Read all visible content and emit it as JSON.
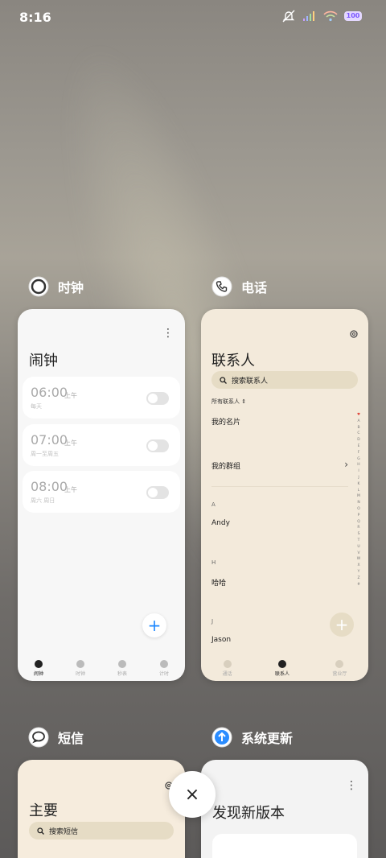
{
  "status": {
    "time": "8:16",
    "battery": "100"
  },
  "apps": {
    "clock": {
      "name": "时钟",
      "title": "闹钟",
      "alarms": [
        {
          "time": "06:00",
          "ampm": "上午",
          "repeat": "每天"
        },
        {
          "time": "07:00",
          "ampm": "上午",
          "repeat": "周一至周五"
        },
        {
          "time": "08:00",
          "ampm": "上午",
          "repeat": "周六 周日"
        }
      ],
      "fab": "+",
      "nav": [
        "闹钟",
        "时钟",
        "秒表",
        "计时"
      ]
    },
    "phone": {
      "name": "电话",
      "title": "联系人",
      "search_placeholder": "搜索联系人",
      "filter": "所有联系人 ⇕",
      "my_card": "我的名片",
      "my_groups": "我的群组",
      "sections": [
        {
          "letter": "A",
          "name": "Andy"
        },
        {
          "letter": "H",
          "name": "哈哈"
        },
        {
          "letter": "J",
          "name": "Jason"
        }
      ],
      "index": [
        "♥",
        "A",
        "B",
        "C",
        "D",
        "E",
        "F",
        "G",
        "H",
        "I",
        "J",
        "K",
        "L",
        "M",
        "N",
        "O",
        "P",
        "Q",
        "R",
        "S",
        "T",
        "U",
        "V",
        "W",
        "X",
        "Y",
        "Z",
        "#"
      ],
      "fab": "+",
      "nav": [
        "通话",
        "联系人",
        "营业厅"
      ]
    },
    "messages": {
      "name": "短信",
      "title": "主要",
      "search_placeholder": "搜索短信"
    },
    "update": {
      "name": "系统更新",
      "title": "发现新版本"
    }
  },
  "close_button": "×",
  "colors": {
    "accent_blue": "#1e88ff",
    "phone_bg": "#f3eadb",
    "clock_bg": "#f7f7f7"
  }
}
